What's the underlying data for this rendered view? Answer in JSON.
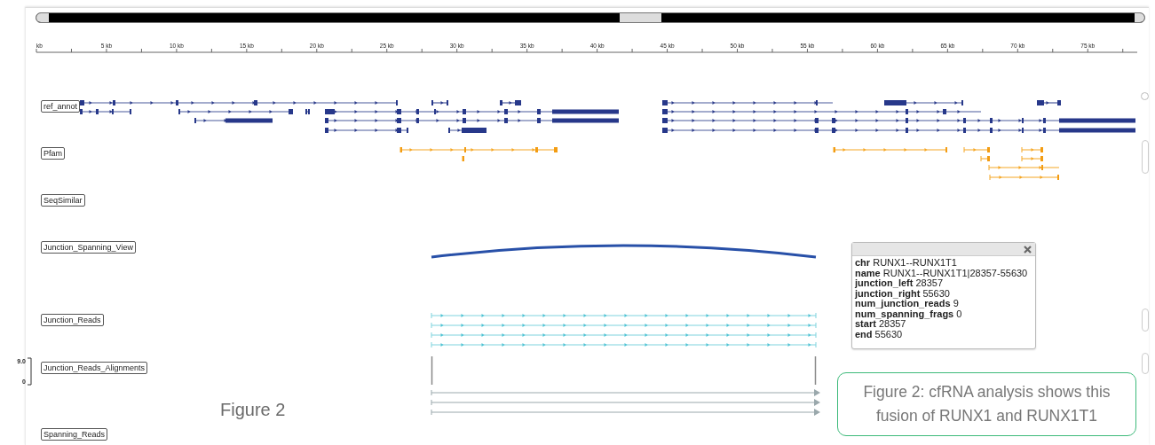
{
  "ruler": {
    "ticks": [
      "kb",
      "5 kb",
      "10 kb",
      "15 kb",
      "20 kb",
      "25 kb",
      "30 kb",
      "35 kb",
      "40 kb",
      "45 kb",
      "50 kb",
      "55 kb",
      "60 kb",
      "65 kb",
      "70 kb",
      "75 kb"
    ]
  },
  "tracks": [
    {
      "label": "ref_annot"
    },
    {
      "label": "Pfam"
    },
    {
      "label": "SeqSimilar"
    },
    {
      "label": "Junction_Spanning_View"
    },
    {
      "label": "Junction_Reads"
    },
    {
      "label": "Junction_Reads_Alignments"
    },
    {
      "label": "Spanning_Reads"
    }
  ],
  "alignment_axis": {
    "max": "9.0",
    "min": "0"
  },
  "popup": {
    "fields": [
      {
        "key": "chr",
        "value": "RUNX1--RUNX1T1"
      },
      {
        "key": "name",
        "value": "RUNX1--RUNX1T1|28357-55630"
      },
      {
        "key": "junction_left",
        "value": "28357"
      },
      {
        "key": "junction_right",
        "value": "55630"
      },
      {
        "key": "num_junction_reads",
        "value": "9"
      },
      {
        "key": "num_spanning_frags",
        "value": "0"
      },
      {
        "key": "start",
        "value": "28357"
      },
      {
        "key": "end",
        "value": "55630"
      }
    ]
  },
  "figure_label": "Figure 2",
  "caption": "Figure 2: cfRNA analysis shows this fusion of RUNX1 and RUNX1T1"
}
